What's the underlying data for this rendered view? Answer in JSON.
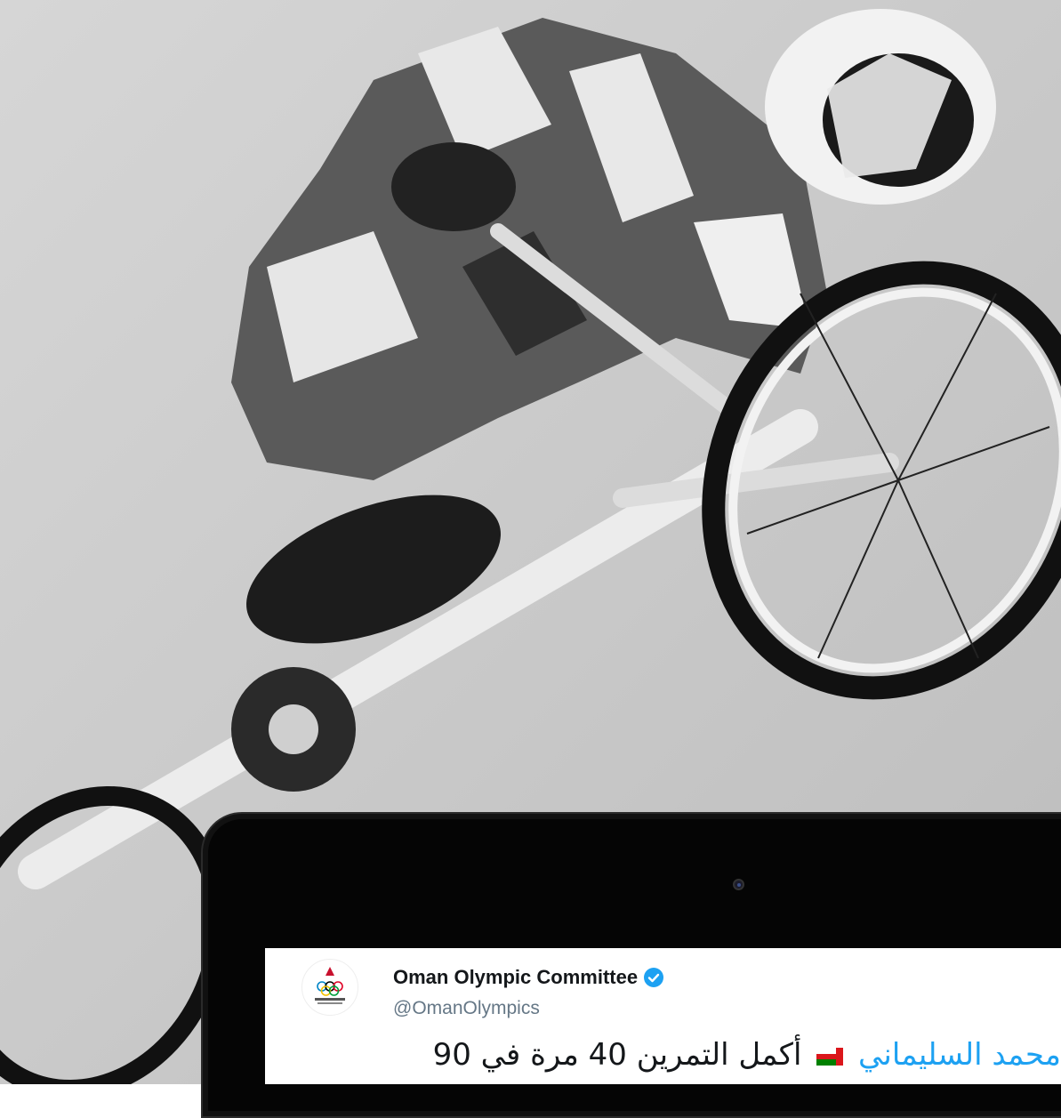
{
  "photo": {
    "subject": "bmx-rider",
    "tone": "grayscale"
  },
  "tweet": {
    "display_name": "Oman Olympic Committee",
    "handle": "@OmanOlympics",
    "verified": true,
    "text_mention": "محمد السليماني",
    "text_body": "أكمل التمرين 40 مرة في 90",
    "flag": "oman-flag"
  },
  "colors": {
    "accent": "#1da1f2",
    "text": "#14171a",
    "muted": "#657786"
  }
}
